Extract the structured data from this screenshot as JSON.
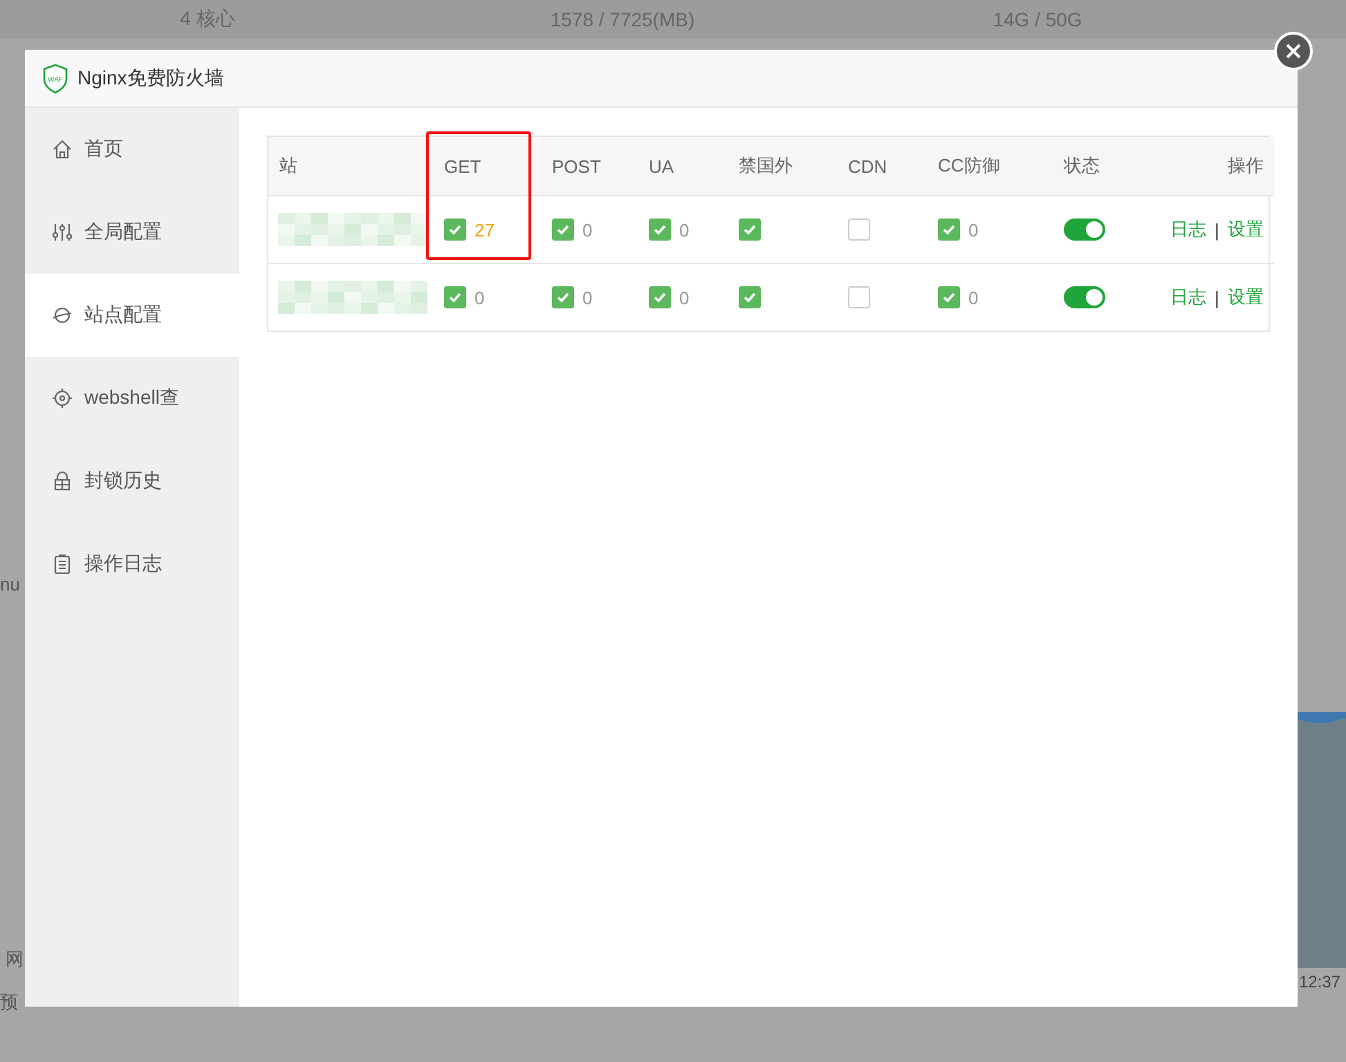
{
  "background": {
    "stats": [
      "4 核心",
      "1578 / 7725(MB)",
      "14G / 50G"
    ],
    "fragments": [
      "nu",
      "网",
      "预"
    ],
    "chart_time": "12:37"
  },
  "dialog": {
    "logo_text": "WAF",
    "title": "Nginx免费防火墙"
  },
  "sidebar": {
    "items": [
      {
        "label": "首页",
        "selected": false
      },
      {
        "label": "全局配置",
        "selected": false
      },
      {
        "label": "站点配置",
        "selected": true
      },
      {
        "label": "webshell查",
        "selected": false
      },
      {
        "label": "封锁历史",
        "selected": false
      },
      {
        "label": "操作日志",
        "selected": false
      }
    ]
  },
  "table": {
    "columns": [
      "站",
      "GET",
      "POST",
      "UA",
      "禁国外",
      "CDN",
      "CC防御",
      "状态",
      "操作"
    ],
    "action_separator": "|",
    "rows": [
      {
        "checks": [
          {
            "checked": true,
            "count": "27",
            "warn": true
          },
          {
            "checked": true,
            "count": "0",
            "warn": false
          },
          {
            "checked": true,
            "count": "0",
            "warn": false
          },
          {
            "checked": true
          },
          {
            "checked": false
          },
          {
            "checked": true,
            "count": "0",
            "warn": false
          }
        ],
        "enabled": true,
        "actions": [
          "日志",
          "设置"
        ]
      },
      {
        "checks": [
          {
            "checked": true,
            "count": "0",
            "warn": false
          },
          {
            "checked": true,
            "count": "0",
            "warn": false
          },
          {
            "checked": true,
            "count": "0",
            "warn": false
          },
          {
            "checked": true
          },
          {
            "checked": false
          },
          {
            "checked": true,
            "count": "0",
            "warn": false
          }
        ],
        "enabled": true,
        "actions": [
          "日志",
          "设置"
        ]
      }
    ]
  }
}
